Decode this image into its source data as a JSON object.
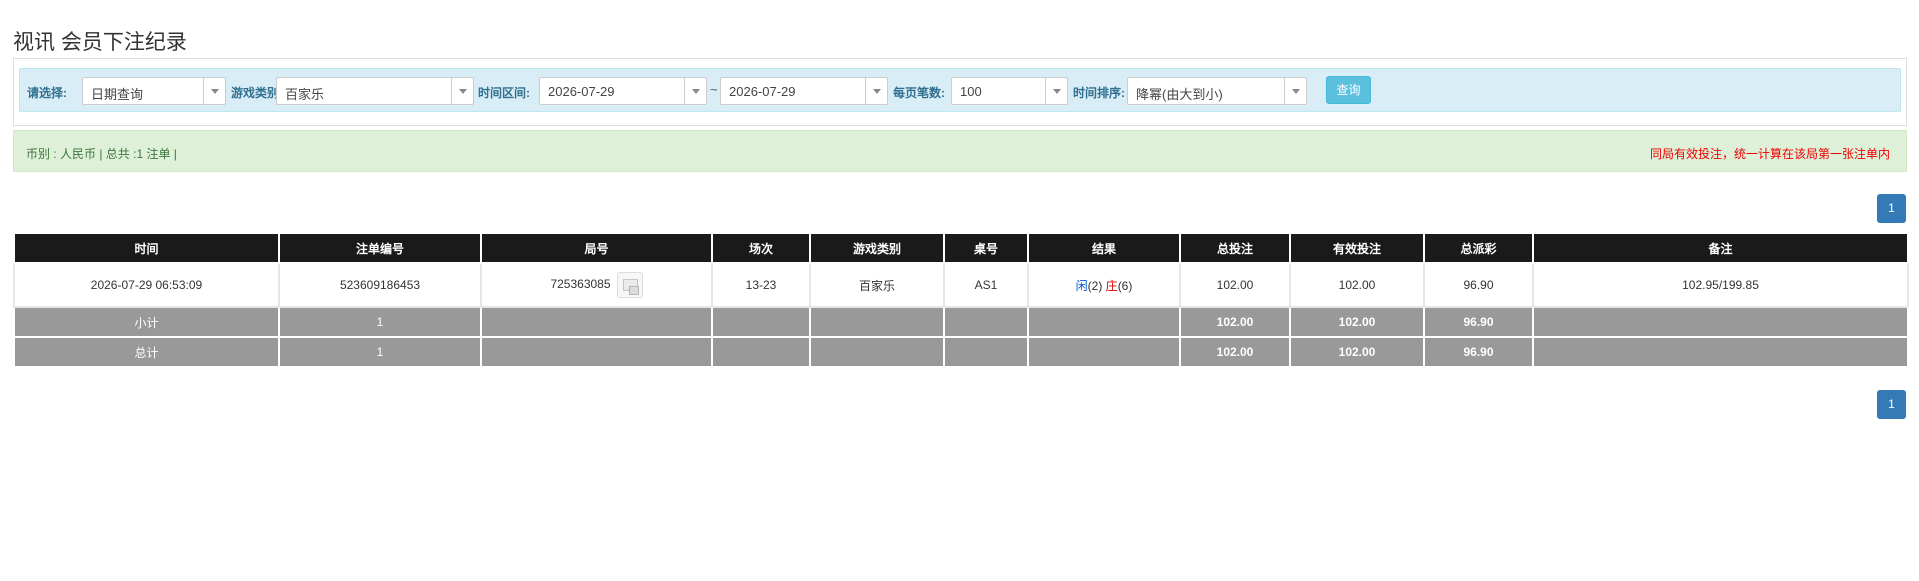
{
  "page": {
    "title": "视讯 会员下注纪录"
  },
  "filter": {
    "select_label": "请选择:",
    "select_value": "日期查询",
    "game_type_label": "游戏类别",
    "game_type_value": "百家乐",
    "range_label": "时间区间:",
    "date_from": "2026-07-29",
    "tilde": "~",
    "date_to": "2026-07-29",
    "per_page_label": "每页笔数:",
    "per_page_value": "100",
    "sort_label": "时间排序:",
    "sort_value": "降幂(由大到小)",
    "query_button": "查询"
  },
  "info": {
    "left": "币别 : 人民币 | 总共 :1 注单 |",
    "right": "同局有效投注，统一计算在该局第一张注单内"
  },
  "pagination": {
    "current_page": "1"
  },
  "table": {
    "headers": [
      "时间",
      "注单编号",
      "局号",
      "场次",
      "游戏类别",
      "桌号",
      "结果",
      "总投注",
      "有效投注",
      "总派彩",
      "备注"
    ],
    "row": {
      "time": "2026-07-29 06:53:09",
      "bet_no": "523609186453",
      "round_no": "725363085",
      "session": "13-23",
      "game_type": "百家乐",
      "table_no": "AS1",
      "result_player": "闲",
      "result_player_score": "(2)",
      "result_banker": "庄",
      "result_banker_score": "(6)",
      "total_bet": "102.00",
      "valid_bet": "102.00",
      "payout": "96.90",
      "remark": "102.95/199.85"
    },
    "subtotal": {
      "label": "小计",
      "count": "1",
      "total_bet": "102.00",
      "valid_bet": "102.00",
      "payout": "96.90"
    },
    "total": {
      "label": "总计",
      "count": "1",
      "total_bet": "102.00",
      "valid_bet": "102.00",
      "payout": "96.90"
    }
  },
  "icons": {
    "round_detail": "round-detail-icon",
    "dropdown": "chevron-down-icon"
  },
  "colors": {
    "header_bg": "#1a1a1a",
    "summary_bg": "#999999",
    "filter_bg": "#d9edf7",
    "info_bg": "#dff0d8",
    "primary": "#337ab7",
    "query_btn": "#5bc0de",
    "player": "#0055dd",
    "banker": "#dd0000"
  }
}
